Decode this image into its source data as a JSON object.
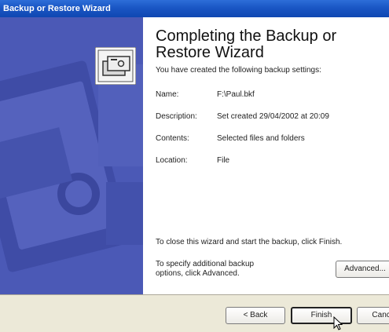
{
  "window": {
    "title": "Backup or Restore Wizard"
  },
  "main": {
    "heading": "Completing the Backup or Restore Wizard",
    "intro": "You have created the following backup settings:",
    "fields": [
      {
        "label": "Name:",
        "value": "F:\\Paul.bkf"
      },
      {
        "label": "Description:",
        "value": "Set created 29/04/2002 at 20:09"
      },
      {
        "label": "Contents:",
        "value": "Selected files and folders"
      },
      {
        "label": "Location:",
        "value": "File"
      }
    ],
    "close_text": "To close this wizard and start the backup, click Finish.",
    "advanced_text": "To specify additional backup options, click Advanced.",
    "advanced_button": "Advanced..."
  },
  "footer": {
    "back_button": "< Back",
    "finish_button": "Finish",
    "cancel_button": "Cancel"
  },
  "colors": {
    "titlebar": "#1a56c4",
    "left_panel": "#4b59b6",
    "footer": "#ece9d8"
  },
  "icons": [
    "backup-cards-icon",
    "mouse-cursor-icon"
  ]
}
